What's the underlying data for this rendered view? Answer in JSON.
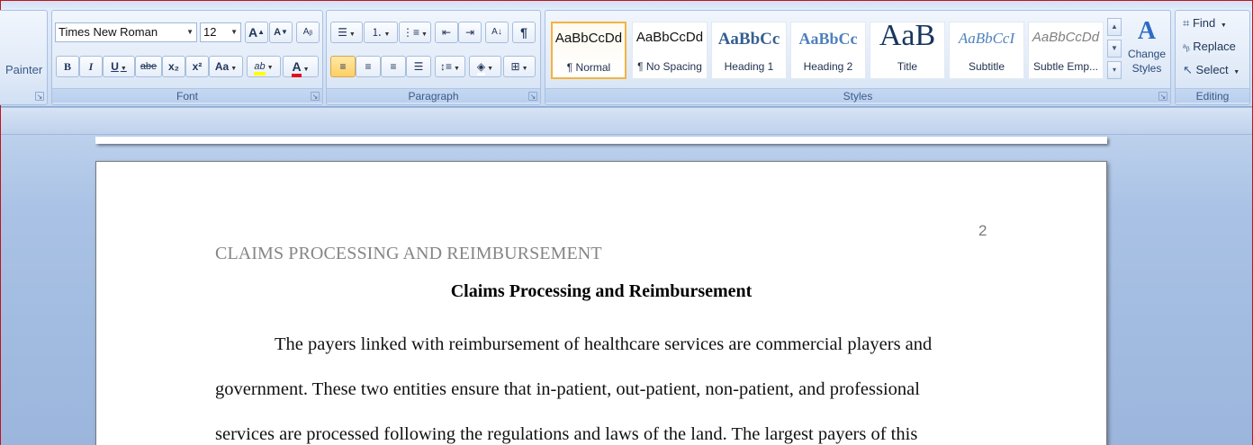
{
  "clipboard": {
    "painter_label": "Painter"
  },
  "font": {
    "group_label": "Font",
    "font_name": "Times New Roman",
    "font_size": "12",
    "grow_glyph": "A",
    "shrink_glyph": "A",
    "bold": "B",
    "italic": "I",
    "underline": "U",
    "strike": "abe",
    "subscript": "x₂",
    "superscript": "x²",
    "case": "Aa",
    "highlight": "ab",
    "font_color": "A"
  },
  "paragraph": {
    "group_label": "Paragraph",
    "pilcrow": "¶"
  },
  "styles": {
    "group_label": "Styles",
    "change_styles_label": "Change Styles",
    "items": [
      {
        "sample": "AaBbCcDd",
        "name": "¶ Normal"
      },
      {
        "sample": "AaBbCcDd",
        "name": "¶ No Spacing"
      },
      {
        "sample": "AaBbCc",
        "name": "Heading 1"
      },
      {
        "sample": "AaBbCc",
        "name": "Heading 2"
      },
      {
        "sample": "AaB",
        "name": "Title"
      },
      {
        "sample": "AaBbCcI",
        "name": "Subtitle"
      },
      {
        "sample": "AaBbCcDd",
        "name": "Subtle Emp..."
      }
    ]
  },
  "editing": {
    "group_label": "Editing",
    "find_label": "Find",
    "replace_label": "Replace",
    "select_label": "Select"
  },
  "document": {
    "page_number": "2",
    "running_head": "CLAIMS PROCESSING AND REIMBURSEMENT",
    "title": "Claims Processing and Reimbursement",
    "lines": [
      "The payers linked with reimbursement of healthcare services are commercial players and",
      "government. These two entities ensure that in-patient, out-patient, non-patient, and professional",
      "services are processed following the regulations and laws of the land. The largest payers of this"
    ]
  },
  "colors": {
    "ribbon_label": "#3b5a86",
    "highlight_swatch": "#ffff00",
    "font_color_swatch": "#e0121b",
    "selected_style_border": "#f3b33f"
  }
}
